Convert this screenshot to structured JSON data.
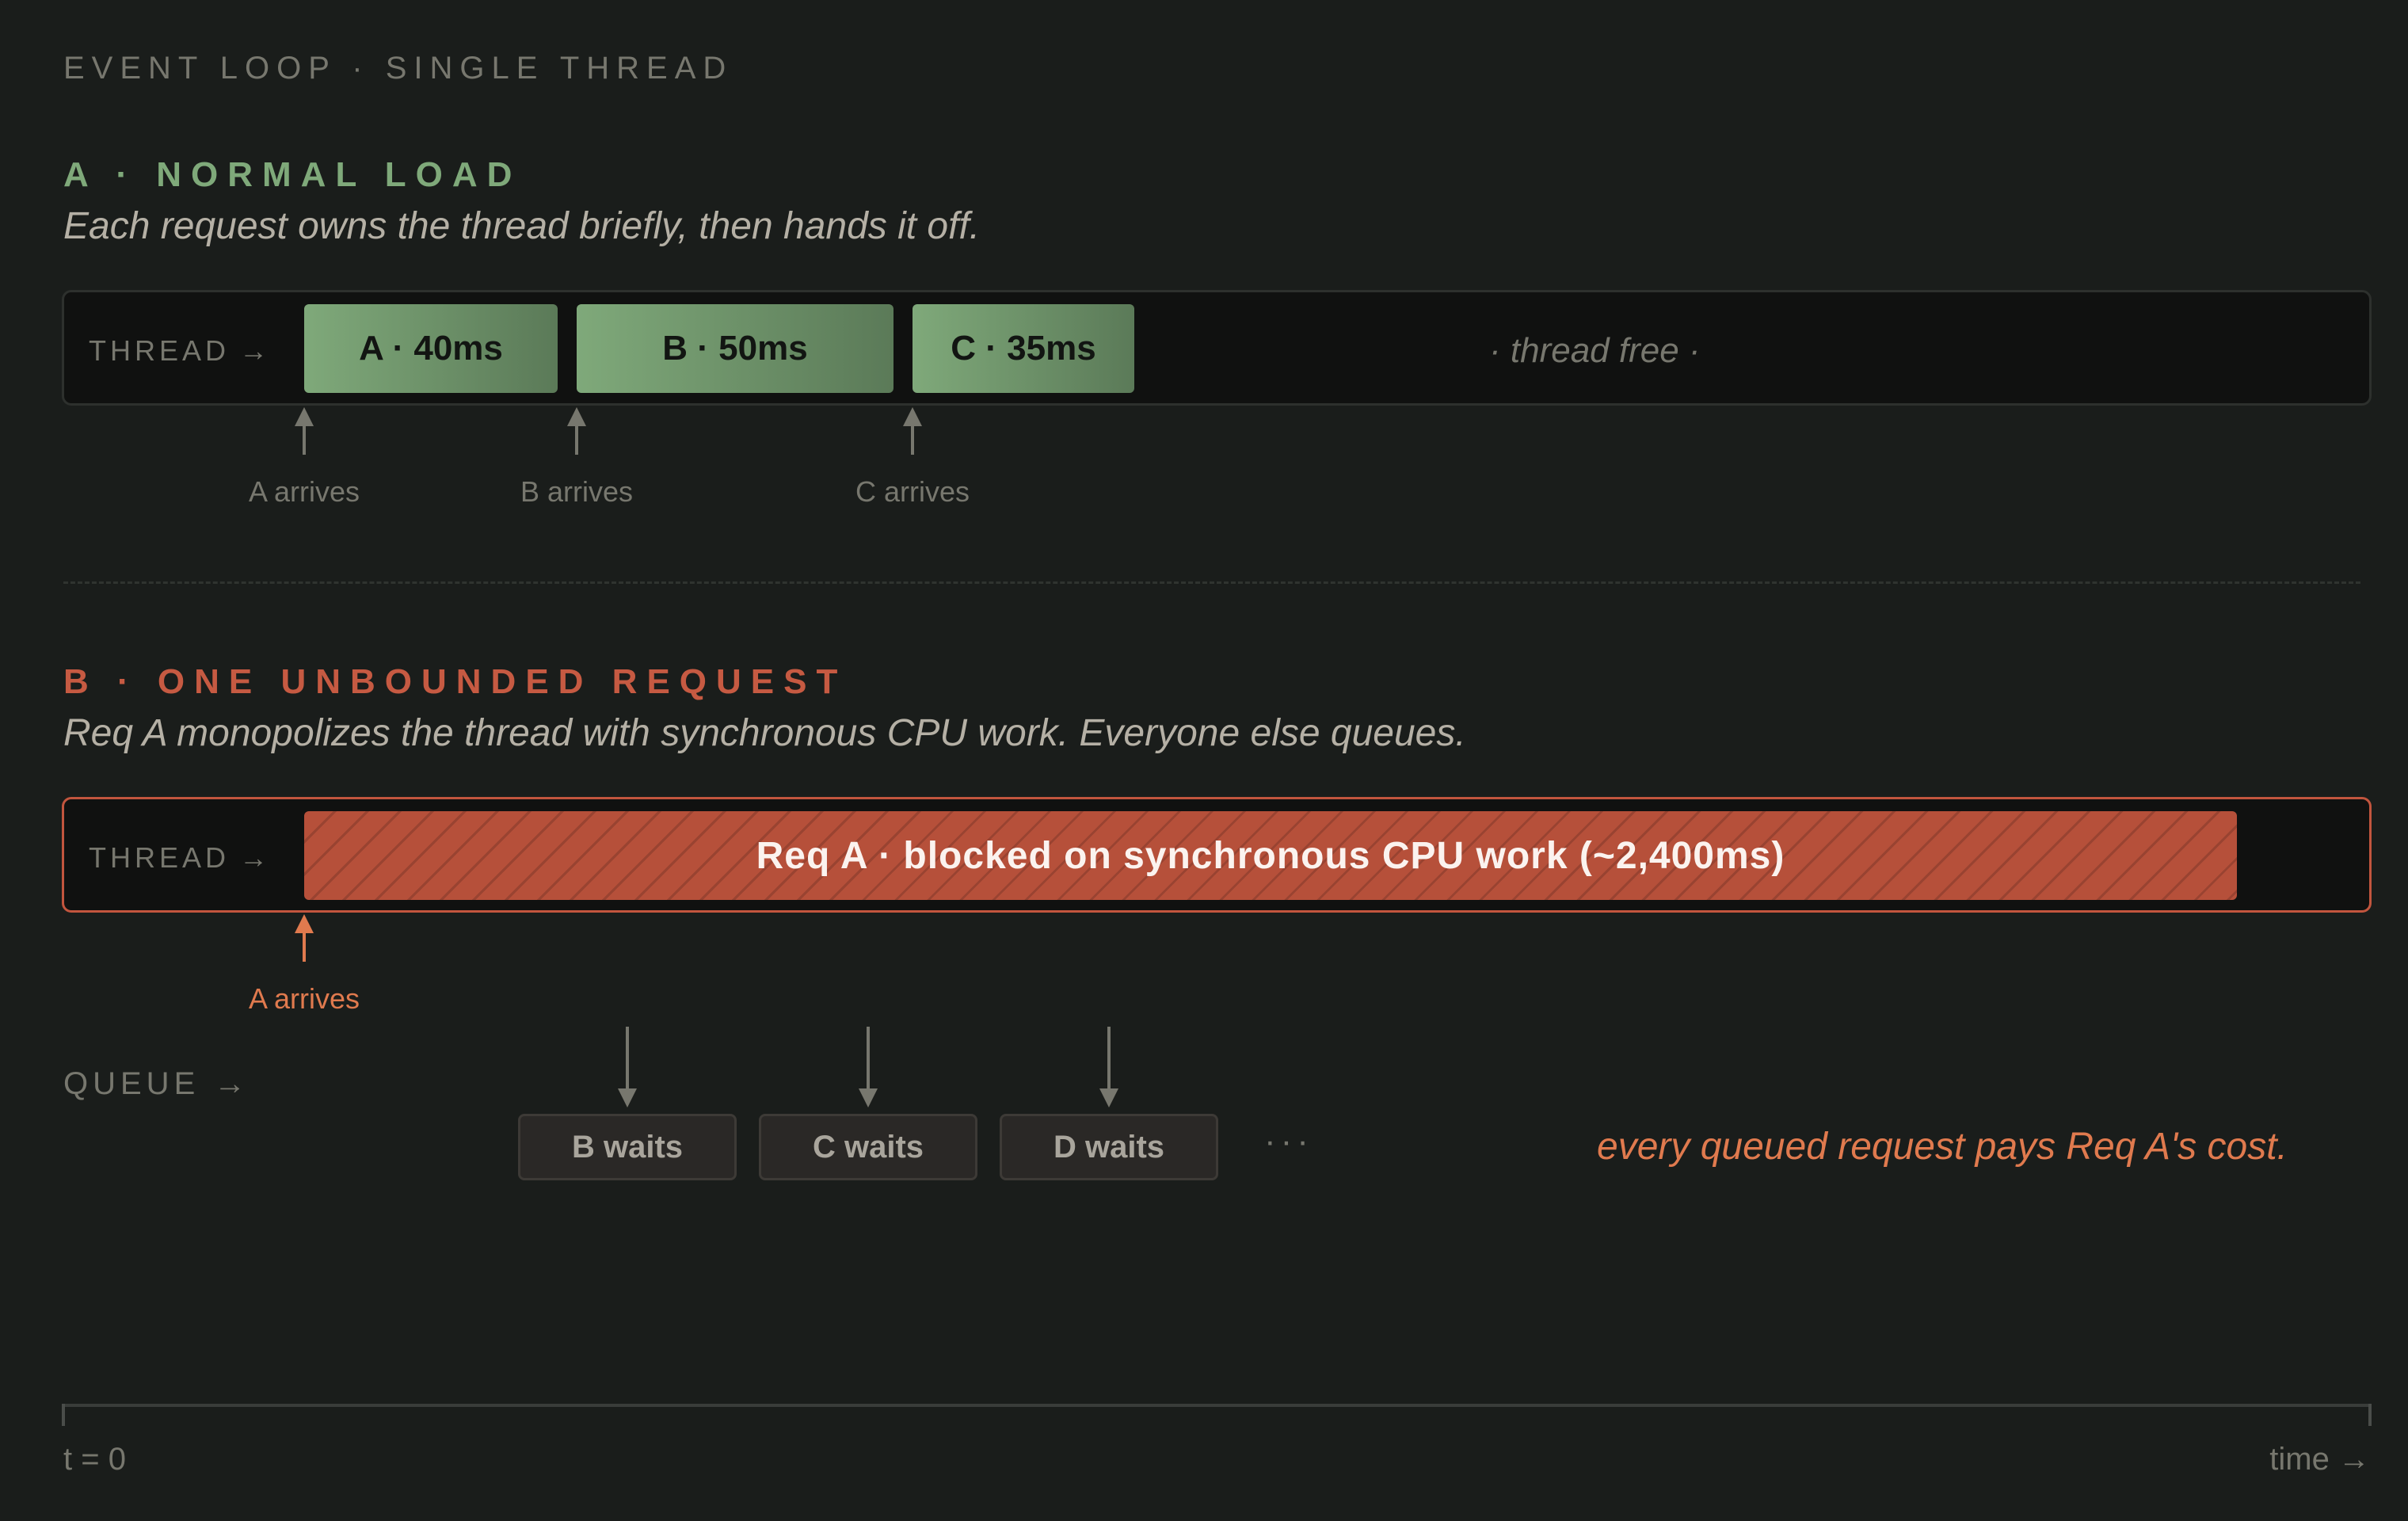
{
  "page": {
    "title": "EVENT LOOP · SINGLE THREAD"
  },
  "colors": {
    "background": "#1a1d1b",
    "normal_accent": "#7fa97a",
    "blocked_accent": "#c65a42",
    "warning_text": "#e07a4e"
  },
  "section_a": {
    "title": "A · NORMAL LOAD",
    "subtitle": "Each request owns the thread briefly, then hands it off.",
    "track_label": "THREAD",
    "track_arrow": "→",
    "blocks": [
      {
        "label": "A · 40ms"
      },
      {
        "label": "B · 50ms"
      },
      {
        "label": "C · 35ms"
      }
    ],
    "free_label": "· thread free ·",
    "arrivals": [
      "A arrives",
      "B arrives",
      "C arrives"
    ]
  },
  "section_b": {
    "title": "B · ONE UNBOUNDED REQUEST",
    "subtitle": "Req A monopolizes the thread with synchronous CPU work. Everyone else queues.",
    "track_label": "THREAD",
    "track_arrow": "→",
    "blocked_label": "Req A · blocked on synchronous CPU work (~2,400ms)",
    "arrival": "A arrives",
    "queue_label": "QUEUE",
    "queue_arrow": "→",
    "waits": [
      "B waits",
      "C waits",
      "D waits"
    ],
    "ellipsis": "···",
    "note": "every queued request pays Req A's cost."
  },
  "axis": {
    "start": "t = 0",
    "end": "time",
    "end_arrow": "→"
  }
}
